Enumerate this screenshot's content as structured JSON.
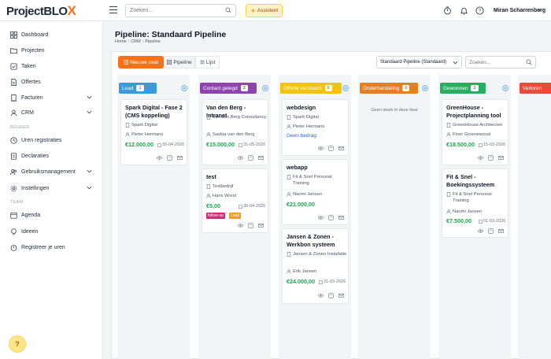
{
  "app": {
    "logo_prefix": "Project",
    "logo_suffix": "BLO",
    "logo_accent": "X",
    "search_placeholder": "Zoeken...",
    "assistant_label": "Assistent",
    "user_name": "Miran Scharrenberg"
  },
  "sidebar": {
    "items": [
      {
        "label": "Dashboard",
        "icon": "dashboard-icon"
      },
      {
        "label": "Projecten",
        "icon": "folder-icon"
      },
      {
        "label": "Taken",
        "icon": "tasks-icon"
      },
      {
        "label": "Offertes",
        "icon": "document-icon"
      },
      {
        "label": "Facturen",
        "icon": "invoice-icon"
      },
      {
        "label": "CRM",
        "icon": "crm-icon"
      },
      {
        "label": "Uren registraties",
        "icon": "clock-icon"
      },
      {
        "label": "Declaraties",
        "icon": "receipt-icon"
      },
      {
        "label": "Gebruiksmanagement",
        "icon": "users-icon"
      },
      {
        "label": "Instellingen",
        "icon": "gear-icon"
      },
      {
        "label": "Agenda",
        "icon": "calendar-icon"
      },
      {
        "label": "Ideeen",
        "icon": "lightbulb-icon"
      },
      {
        "label": "Registreer je uren",
        "icon": "stopwatch-icon"
      }
    ],
    "section_beheer": "BEHEER",
    "section_team": "TEAM",
    "help_label": "?"
  },
  "page": {
    "title": "Pipeline: Standaard Pipeline",
    "breadcrumb": [
      "Home",
      "CRM",
      "Pipeline"
    ],
    "new_deal_label": "Nieuwe deal",
    "view_pipeline": "Pipeline",
    "view_list": "Lijst",
    "pipeline_select": "Standaard Pipeline (Standaard)",
    "board_search_placeholder": "Zoeken..."
  },
  "colors": {
    "brand": "#f97316",
    "lead": "#3b9ad9",
    "contact": "#8e44ad",
    "offerte": "#f1c40f",
    "onderhandeling": "#e67e22",
    "gewonnen": "#27ae60",
    "verloren": "#e74c3c",
    "amount": "#16a34a"
  },
  "columns": [
    {
      "name": "Lead",
      "count": "1"
    },
    {
      "name": "Contact gelegd",
      "count": "2"
    },
    {
      "name": "Offerte verstuurd",
      "count": "5"
    },
    {
      "name": "Onderhandeling",
      "count": "0",
      "empty": "Geen deals in deze fase"
    },
    {
      "name": "Gewonnen",
      "count": "2"
    },
    {
      "name": "Verloren",
      "count": ""
    }
  ],
  "deals": {
    "lead_1": {
      "title": "Spark Digital - Fase 2 (CMS koppeling)",
      "company": "Spark Digital",
      "contact": "Pieter Hermans",
      "amount": "€12.000,00",
      "date": "30-04-2026"
    },
    "contact_1": {
      "title": "Van den Berg - Intranet",
      "company": "Van den Berg Consultancy",
      "contact": "Saskia van den Berg",
      "amount": "€15.000,00",
      "date": "31-05-2026"
    },
    "contact_2": {
      "title": "test",
      "company": "Testbedrijf",
      "contact": "Hans Worst",
      "amount": "€5,00",
      "date": "30-04-2025",
      "tags": [
        "follow-up",
        "Lead"
      ]
    },
    "offerte_1": {
      "title": "webdesign",
      "company": "Spark Digital",
      "contact": "Pieter Hermans",
      "no_amount": "Geen bedrag"
    },
    "offerte_2": {
      "title": "webapp",
      "company": "Fit & Snel Personal Training",
      "contact": "Naomi Jansen",
      "amount": "€21.000,00"
    },
    "offerte_3": {
      "title": "Jansen & Zonen - Werkbon systeem",
      "company": "Jansen & Zonen Installatie",
      "contact": "Erik Jansen",
      "amount": "€24.000,00",
      "date": "31-03-2026"
    },
    "won_1": {
      "title": "GreenHouse - Projectplanning tool",
      "company": "GreenHouse Architecten",
      "contact": "Floor Groenewoud",
      "amount": "€18.500,00",
      "date": "15-03-2026"
    },
    "won_2": {
      "title": "Fit & Snel - Boekingssysteem",
      "company": "Fit & Snel Personal Training",
      "contact": "Naomi Jansen",
      "amount": "€7.500,00",
      "date": "01-03-2026"
    }
  }
}
